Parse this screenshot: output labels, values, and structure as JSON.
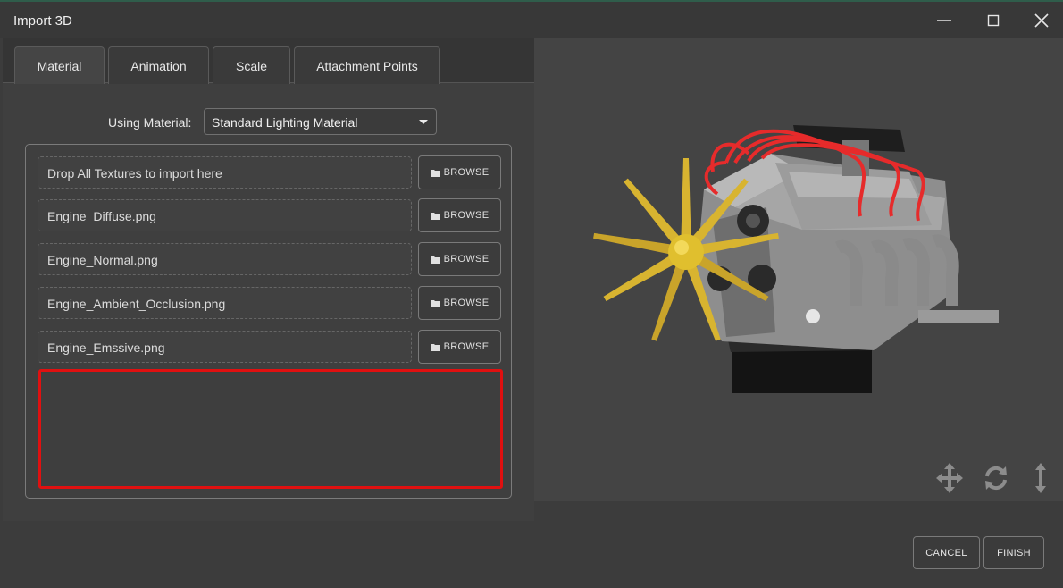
{
  "window": {
    "title": "Import 3D"
  },
  "tabs": [
    {
      "label": "Material"
    },
    {
      "label": "Animation"
    },
    {
      "label": "Scale"
    },
    {
      "label": "Attachment Points"
    }
  ],
  "material": {
    "using_label": "Using Material:",
    "selected": "Standard Lighting Material"
  },
  "textures": [
    {
      "value": "Drop All Textures to import here",
      "browse_label": "BROWSE"
    },
    {
      "value": "Engine_Diffuse.png",
      "browse_label": "BROWSE"
    },
    {
      "value": "Engine_Normal.png",
      "browse_label": "BROWSE"
    },
    {
      "value": "Engine_Ambient_Occlusion.png",
      "browse_label": "BROWSE"
    },
    {
      "value": "Engine_Emssive.png",
      "browse_label": "BROWSE"
    }
  ],
  "viewport": {
    "controls": [
      "move-icon",
      "rotate-icon",
      "scale-vertical-icon"
    ]
  },
  "footer": {
    "cancel_label": "CANCEL",
    "finish_label": "FINISH"
  },
  "colors": {
    "highlight": "#e01010",
    "background": "#3c3c3c",
    "accent_line": "#2f5d4b"
  }
}
